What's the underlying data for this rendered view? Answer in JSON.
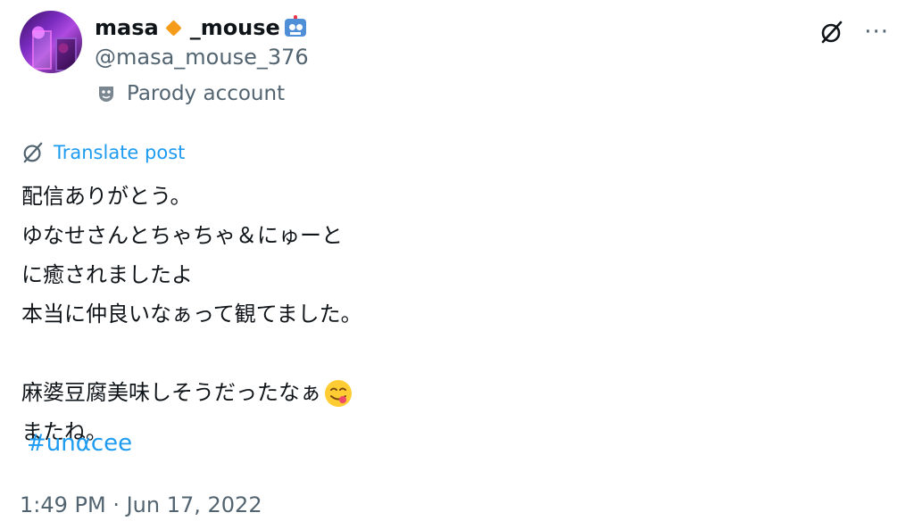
{
  "author": {
    "display_name": "masa",
    "display_name_suffix": "_mouse",
    "handle": "@masa_mouse_376",
    "account_label": "Parody account",
    "name_emoji": "robot-icon",
    "badge_color": "#f59c1a"
  },
  "actions": {
    "grok_icon": "grok-icon",
    "more_icon": "more-icon"
  },
  "post": {
    "translate_label": "Translate post",
    "lines": [
      "配信ありがとう。",
      "ゆなせさんとちゃちゃ＆にゅーと",
      "に癒されましたよ",
      "本当に仲良いなぁって観てました。",
      "",
      "麻婆豆腐美味しそうだったなぁ",
      "またね。"
    ],
    "emoji_after_line_6": "yum-face-emoji",
    "hashtag": "#unαcee",
    "timestamp": "1:49 PM · Jun 17, 2022"
  },
  "colors": {
    "link": "#1d9bf0",
    "secondary_text": "#536471",
    "primary_text": "#0f1419"
  }
}
